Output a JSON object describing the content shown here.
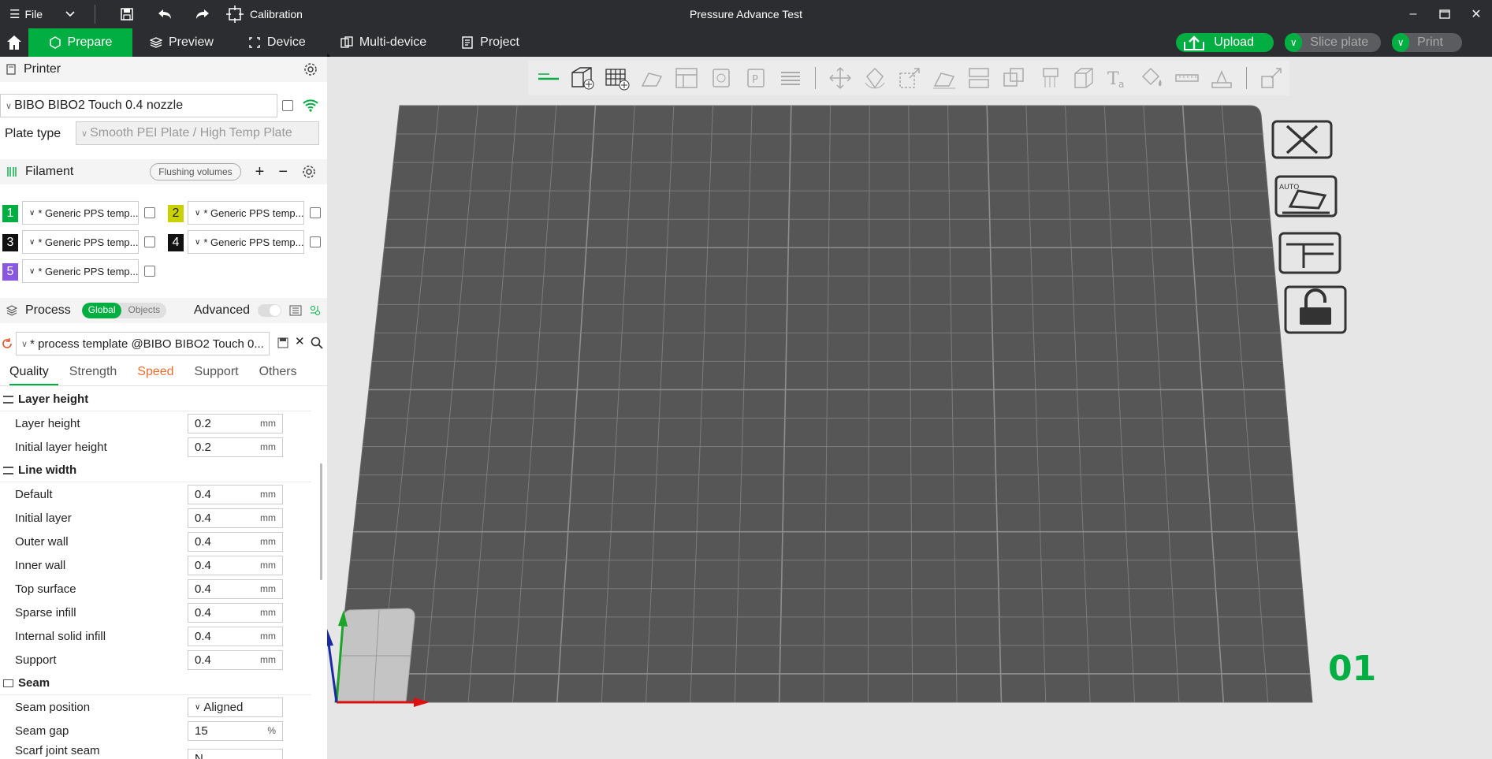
{
  "titlebar": {
    "file_label": "File",
    "calibration_label": "Calibration",
    "window_title": "Pressure Advance Test"
  },
  "menubar": {
    "tabs": [
      {
        "label": "Prepare"
      },
      {
        "label": "Preview"
      },
      {
        "label": "Device"
      },
      {
        "label": "Multi-device"
      },
      {
        "label": "Project"
      }
    ],
    "upload_label": "Upload",
    "slice_label": "Slice plate",
    "print_label": "Print"
  },
  "printer": {
    "section_title": "Printer",
    "selected_printer": "BIBO BIBO2 Touch 0.4 nozzle",
    "plate_type_label": "Plate type",
    "plate_type_value": "Smooth PEI Plate / High Temp Plate"
  },
  "filament": {
    "section_title": "Filament",
    "flushing_label": "Flushing volumes",
    "slots": [
      {
        "num": "1",
        "color": "#00ae42",
        "name": "* Generic PPS temp..."
      },
      {
        "num": "2",
        "color": "#c9d200",
        "name": "* Generic PPS temp..."
      },
      {
        "num": "3",
        "color": "#111111",
        "name": "* Generic PPS temp..."
      },
      {
        "num": "4",
        "color": "#111111",
        "name": "* Generic PPS temp..."
      },
      {
        "num": "5",
        "color": "#8a57e0",
        "name": "* Generic PPS temp..."
      }
    ]
  },
  "process": {
    "section_title": "Process",
    "toggle_global": "Global",
    "toggle_objects": "Objects",
    "advanced_label": "Advanced",
    "preset": "* process template @BIBO BIBO2 Touch 0...",
    "tabs": [
      "Quality",
      "Strength",
      "Speed",
      "Support",
      "Others"
    ],
    "groups": {
      "layer_height": {
        "title": "Layer height",
        "rows": [
          {
            "label": "Layer height",
            "value": "0.2",
            "unit": "mm"
          },
          {
            "label": "Initial layer height",
            "value": "0.2",
            "unit": "mm"
          }
        ]
      },
      "line_width": {
        "title": "Line width",
        "rows": [
          {
            "label": "Default",
            "value": "0.4",
            "unit": "mm"
          },
          {
            "label": "Initial layer",
            "value": "0.4",
            "unit": "mm"
          },
          {
            "label": "Outer wall",
            "value": "0.4",
            "unit": "mm"
          },
          {
            "label": "Inner wall",
            "value": "0.4",
            "unit": "mm"
          },
          {
            "label": "Top surface",
            "value": "0.4",
            "unit": "mm"
          },
          {
            "label": "Sparse infill",
            "value": "0.4",
            "unit": "mm"
          },
          {
            "label": "Internal solid infill",
            "value": "0.4",
            "unit": "mm"
          },
          {
            "label": "Support",
            "value": "0.4",
            "unit": "mm"
          }
        ]
      },
      "seam": {
        "title": "Seam",
        "rows": [
          {
            "label": "Seam position",
            "value": "Aligned",
            "unit": ""
          },
          {
            "label": "Seam gap",
            "value": "15",
            "unit": "%"
          },
          {
            "label": "Scarf joint seam",
            "value": "N",
            "unit": ""
          }
        ]
      }
    }
  },
  "viewport": {
    "plate_number": "01",
    "auto_label": "AUTO"
  },
  "colors": {
    "accent": "#00ae42",
    "titlebar_bg": "#2b2d31",
    "plate_fill": "#565656",
    "warn_tab": "#ef6c2f"
  }
}
